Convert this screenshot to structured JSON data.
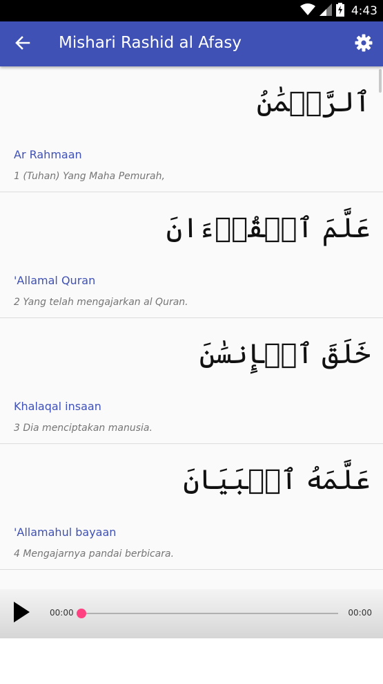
{
  "status_bar": {
    "time": "4:43",
    "icons": [
      "wifi-icon",
      "cellular-signal-icon",
      "battery-charging-icon"
    ]
  },
  "app_bar": {
    "title": "Mishari Rashid al Afasy",
    "back_icon": "arrow-left-icon",
    "settings_icon": "gear-icon",
    "color": "#3f51b5"
  },
  "ayahs": [
    {
      "arabic": "ٱلرَّحۡمَٰنُ",
      "latin": "Ar Rahmaan",
      "translation": "1 (Tuhan) Yang Maha Pemurah,"
    },
    {
      "arabic": "عَلَّمَ ٱلۡقُرۡءَانَ",
      "latin": "'Allamal Quran",
      "translation": "2 Yang telah mengajarkan al Quran."
    },
    {
      "arabic": "خَلَقَ ٱلۡإِنسَٰنَ",
      "latin": "Khalaqal insaan",
      "translation": "3 Dia menciptakan manusia."
    },
    {
      "arabic": "عَلَّمَهُ ٱلۡبَيَانَ",
      "latin": "'Allamahul bayaan",
      "translation": "4 Mengajarnya pandai berbicara."
    }
  ],
  "player": {
    "current_time": "00:00",
    "total_time": "00:00",
    "progress": 0,
    "accent_color": "#ff4081",
    "play_icon": "play-icon"
  }
}
